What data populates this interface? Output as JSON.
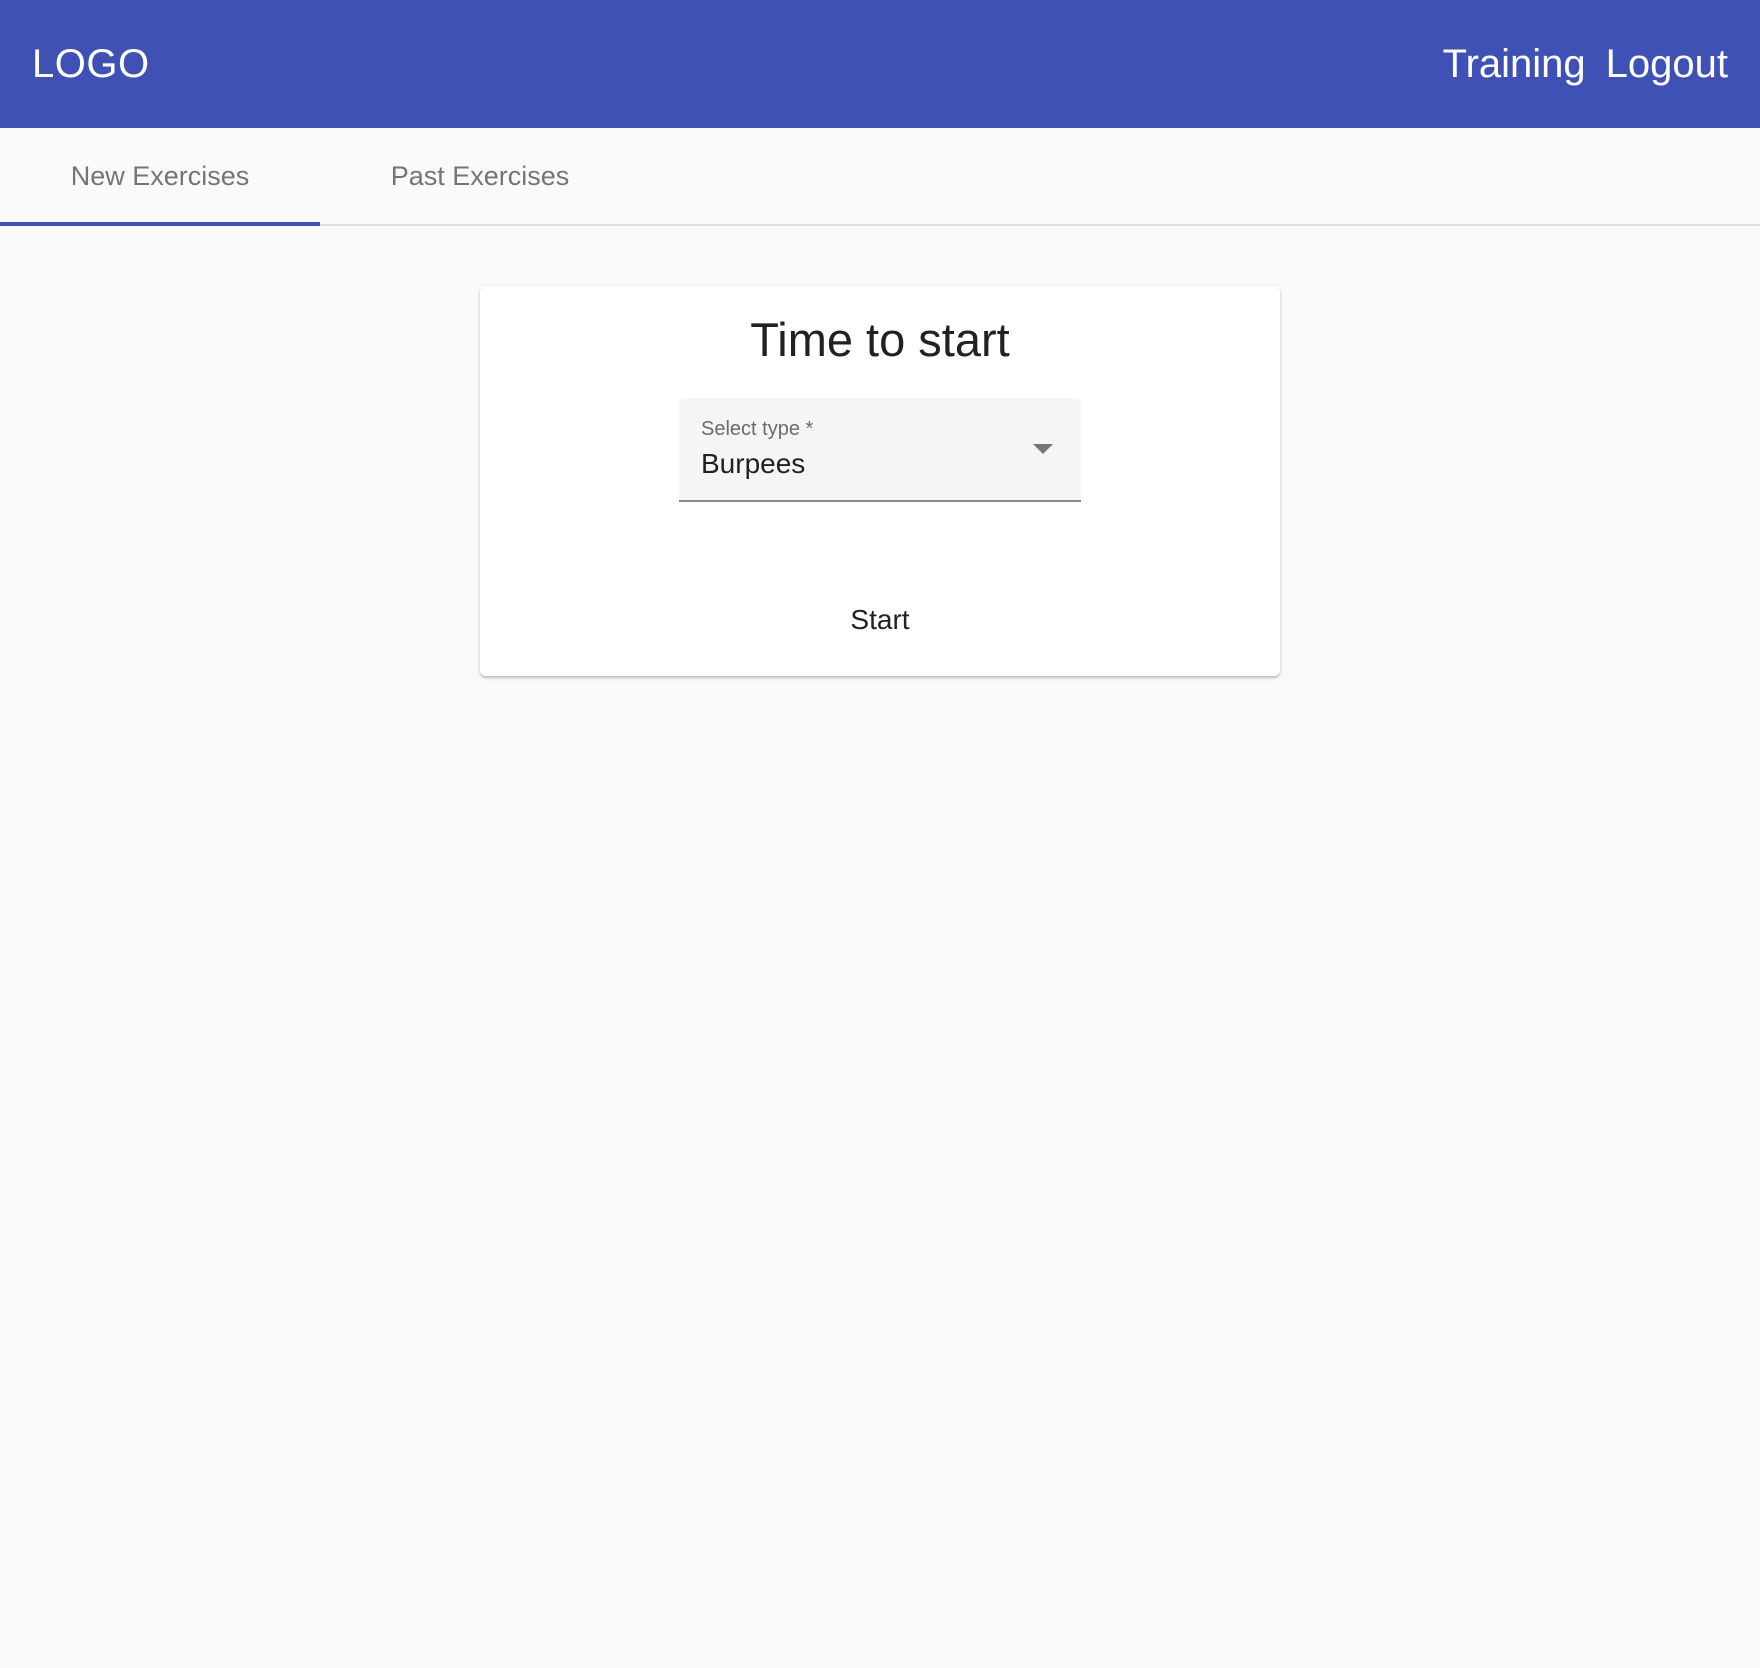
{
  "header": {
    "logo": "LOGO",
    "nav": [
      "Training",
      "Logout"
    ]
  },
  "tabs": [
    {
      "label": "New Exercises",
      "selected": true
    },
    {
      "label": "Past Exercises",
      "selected": false
    }
  ],
  "card": {
    "title": "Time to start",
    "select": {
      "label": "Select type *",
      "value": "Burpees"
    },
    "start_label": "Start"
  },
  "colors": {
    "primary": "#3f51b5",
    "background": "#fafafa",
    "card": "#ffffff",
    "field": "#f5f5f5",
    "muted_text": "#757575"
  }
}
